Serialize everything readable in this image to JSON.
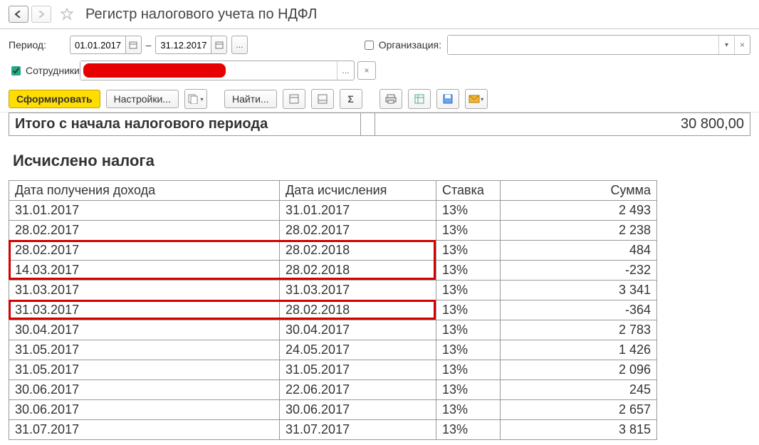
{
  "header": {
    "title": "Регистр налогового учета по НДФЛ"
  },
  "form": {
    "period_label": "Период:",
    "date_from": "01.01.2017",
    "date_to": "31.12.2017",
    "dash": "–",
    "ellipsis": "...",
    "org_label": "Организация:",
    "employees_label": "Сотрудники:"
  },
  "toolbar": {
    "generate": "Сформировать",
    "settings": "Настройки...",
    "find": "Найти..."
  },
  "report": {
    "total_label": "Итого с начала налогового периода",
    "total_value": "30 800,00",
    "section_title": "Исчислено налога",
    "columns": {
      "c1": "Дата получения дохода",
      "c2": "Дата исчисления",
      "c3": "Ставка",
      "c4": "Сумма"
    },
    "rows": [
      {
        "d1": "31.01.2017",
        "d2": "31.01.2017",
        "rate": "13%",
        "sum": "2 493",
        "hl": false
      },
      {
        "d1": "28.02.2017",
        "d2": "28.02.2017",
        "rate": "13%",
        "sum": "2 238",
        "hl": false
      },
      {
        "d1": "28.02.2017",
        "d2": "28.02.2018",
        "rate": "13%",
        "sum": "484",
        "hl": true
      },
      {
        "d1": "14.03.2017",
        "d2": "28.02.2018",
        "rate": "13%",
        "sum": "-232",
        "hl": true
      },
      {
        "d1": "31.03.2017",
        "d2": "31.03.2017",
        "rate": "13%",
        "sum": "3 341",
        "hl": false
      },
      {
        "d1": "31.03.2017",
        "d2": "28.02.2018",
        "rate": "13%",
        "sum": "-364",
        "hl": true
      },
      {
        "d1": "30.04.2017",
        "d2": "30.04.2017",
        "rate": "13%",
        "sum": "2 783",
        "hl": false
      },
      {
        "d1": "31.05.2017",
        "d2": "24.05.2017",
        "rate": "13%",
        "sum": "1 426",
        "hl": false
      },
      {
        "d1": "31.05.2017",
        "d2": "31.05.2017",
        "rate": "13%",
        "sum": "2 096",
        "hl": false
      },
      {
        "d1": "30.06.2017",
        "d2": "22.06.2017",
        "rate": "13%",
        "sum": "245",
        "hl": false
      },
      {
        "d1": "30.06.2017",
        "d2": "30.06.2017",
        "rate": "13%",
        "sum": "2 657",
        "hl": false
      },
      {
        "d1": "31.07.2017",
        "d2": "31.07.2017",
        "rate": "13%",
        "sum": "3 815",
        "hl": false
      }
    ]
  }
}
